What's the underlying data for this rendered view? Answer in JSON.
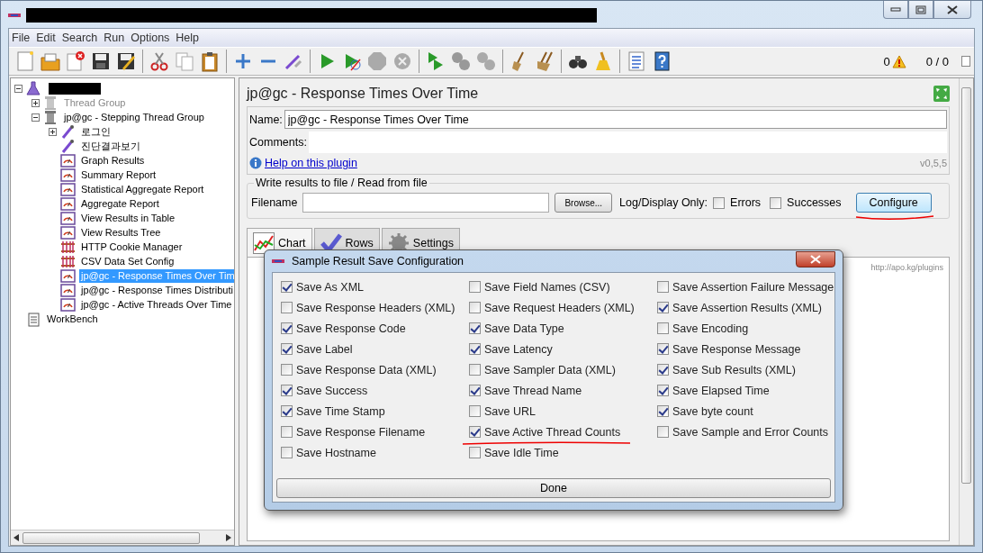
{
  "menu": [
    {
      "label": "File"
    },
    {
      "label": "Edit"
    },
    {
      "label": "Search"
    },
    {
      "label": "Run"
    },
    {
      "label": "Options"
    },
    {
      "label": "Help"
    }
  ],
  "toolbar": {
    "error_count": "0",
    "threads": "0 / 0"
  },
  "tree": [
    {
      "kind": "test-plan",
      "expanded": true,
      "children": [
        {
          "kind": "thread-group",
          "label": "Thread Group",
          "expanded": false,
          "selected": false,
          "disabled": true
        },
        {
          "kind": "thread-group",
          "label": "jp@gc - Stepping Thread Group",
          "expanded": true,
          "selected": false,
          "disabled": false,
          "children": [
            {
              "kind": "sampler",
              "label": "로그인",
              "expanded": false,
              "selected": false,
              "disabled": false
            },
            {
              "kind": "sampler",
              "label": "진단결과보기",
              "selected": false,
              "disabled": false
            },
            {
              "kind": "listener",
              "label": "Graph Results",
              "selected": false,
              "disabled": false
            },
            {
              "kind": "listener",
              "label": "Summary Report",
              "selected": false,
              "disabled": false
            },
            {
              "kind": "listener",
              "label": "Statistical Aggregate Report",
              "selected": false,
              "disabled": false
            },
            {
              "kind": "listener",
              "label": "Aggregate Report",
              "selected": false,
              "disabled": false
            },
            {
              "kind": "listener",
              "label": "View Results in Table",
              "selected": false,
              "disabled": false
            },
            {
              "kind": "listener",
              "label": "View Results Tree",
              "selected": false,
              "disabled": false
            },
            {
              "kind": "config",
              "label": "HTTP Cookie Manager",
              "selected": false,
              "disabled": false
            },
            {
              "kind": "config",
              "label": "CSV Data Set Config",
              "selected": false,
              "disabled": false
            },
            {
              "kind": "listener",
              "label": "jp@gc - Response Times Over Tim",
              "selected": true,
              "disabled": false
            },
            {
              "kind": "listener",
              "label": "jp@gc - Response Times Distributi",
              "selected": false,
              "disabled": false
            },
            {
              "kind": "listener",
              "label": "jp@gc - Active Threads Over Time",
              "selected": false,
              "disabled": false
            }
          ]
        }
      ]
    },
    {
      "kind": "workbench",
      "label": "WorkBench",
      "selected": false,
      "disabled": false
    }
  ],
  "panel": {
    "title": "jp@gc - Response Times Over Time",
    "name_label": "Name:",
    "name_value": "jp@gc - Response Times Over Time",
    "comments_label": "Comments:",
    "help_link": "Help on this plugin",
    "version": "v0,5,5",
    "file_group": {
      "title": "Write results to file / Read from file",
      "filename_label": "Filename",
      "browse_button": "Browse...",
      "log_label": "Log/Display Only:",
      "options": [
        {
          "label": "Errors",
          "checked": false
        },
        {
          "label": "Successes",
          "checked": false
        }
      ],
      "configure_button": {
        "label": "Configure",
        "underlined": true
      }
    },
    "tabs": [
      {
        "label": "Chart",
        "kind": "chart",
        "selected": true
      },
      {
        "label": "Rows",
        "kind": "rows",
        "selected": false
      },
      {
        "label": "Settings",
        "kind": "settings",
        "selected": false
      }
    ],
    "chart_url": "http://apo.kg/plugins"
  },
  "dialog": {
    "title": "Sample Result Save Configuration",
    "columns": [
      [
        {
          "label": "Save As XML",
          "checked": true,
          "underlined": false
        },
        {
          "label": "Save Response Headers (XML)",
          "checked": false,
          "underlined": false
        },
        {
          "label": "Save Response Code",
          "checked": true,
          "underlined": false
        },
        {
          "label": "Save Label",
          "checked": true,
          "underlined": false
        },
        {
          "label": "Save Response Data (XML)",
          "checked": false,
          "underlined": false
        },
        {
          "label": "Save Success",
          "checked": true,
          "underlined": false
        },
        {
          "label": "Save Time Stamp",
          "checked": true,
          "underlined": false
        },
        {
          "label": "Save Response Filename",
          "checked": false,
          "underlined": false
        },
        {
          "label": "Save Hostname",
          "checked": false,
          "underlined": false
        }
      ],
      [
        {
          "label": "Save Field Names (CSV)",
          "checked": false,
          "underlined": false
        },
        {
          "label": "Save Request Headers (XML)",
          "checked": false,
          "underlined": false
        },
        {
          "label": "Save Data Type",
          "checked": true,
          "underlined": false
        },
        {
          "label": "Save Latency",
          "checked": true,
          "underlined": false
        },
        {
          "label": "Save Sampler Data (XML)",
          "checked": false,
          "underlined": false
        },
        {
          "label": "Save Thread Name",
          "checked": true,
          "underlined": false
        },
        {
          "label": "Save URL",
          "checked": false,
          "underlined": false
        },
        {
          "label": "Save Active Thread Counts",
          "checked": true,
          "underlined": true
        },
        {
          "label": "Save Idle Time",
          "checked": false,
          "underlined": false
        }
      ],
      [
        {
          "label": "Save Assertion Failure Message",
          "checked": false,
          "underlined": false
        },
        {
          "label": "Save Assertion Results (XML)",
          "checked": true,
          "underlined": false
        },
        {
          "label": "Save Encoding",
          "checked": false,
          "underlined": false
        },
        {
          "label": "Save Response Message",
          "checked": true,
          "underlined": false
        },
        {
          "label": "Save Sub Results (XML)",
          "checked": true,
          "underlined": false
        },
        {
          "label": "Save Elapsed Time",
          "checked": true,
          "underlined": false
        },
        {
          "label": "Save byte count",
          "checked": true,
          "underlined": false
        },
        {
          "label": "Save Sample and Error Counts",
          "checked": false,
          "underlined": false
        }
      ]
    ],
    "done_button": "Done"
  }
}
